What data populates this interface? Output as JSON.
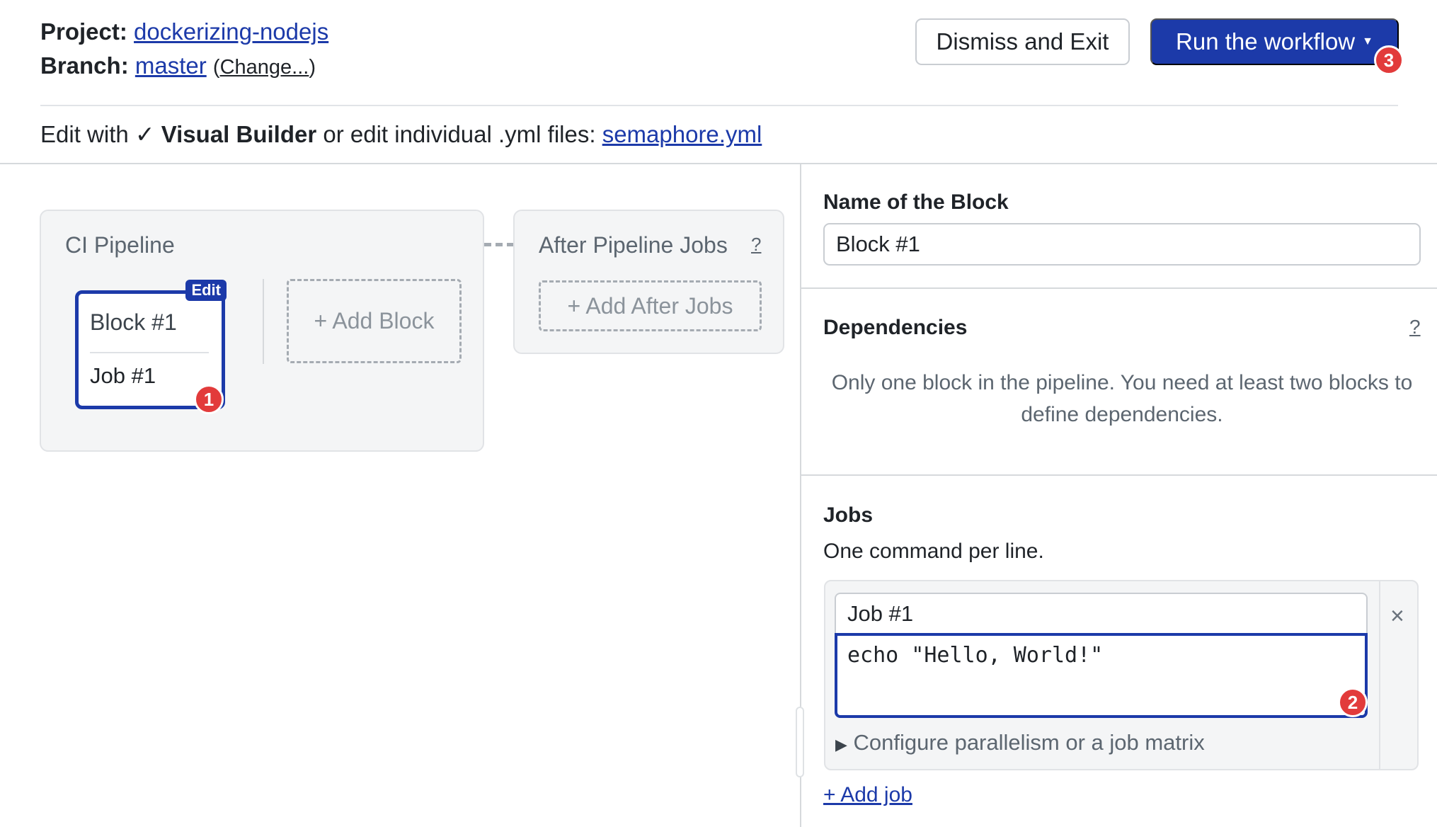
{
  "header": {
    "project_label": "Project:",
    "project_name": "dockerizing-nodejs",
    "branch_label": "Branch:",
    "branch_name": "master",
    "change_open": "(",
    "change_link": "Change...",
    "change_close": ")",
    "dismiss_label": "Dismiss and Exit",
    "run_label": "Run the workflow",
    "run_badge": "3"
  },
  "edit_mode": {
    "prefix": "Edit with",
    "check": "✓",
    "mode": "Visual Builder",
    "middle": "or edit individual .yml files:",
    "file": "semaphore.yml"
  },
  "pipeline": {
    "title": "CI Pipeline",
    "block": {
      "edit_tag": "Edit",
      "name": "Block #1",
      "job": "Job #1",
      "badge": "1"
    },
    "add_block": "+ Add Block"
  },
  "after_jobs": {
    "title": "After Pipeline Jobs",
    "help": "?",
    "add": "+ Add After Jobs"
  },
  "right_panel": {
    "name_title": "Name of the Block",
    "name_value": "Block #1",
    "dependencies_title": "Dependencies",
    "dependencies_help": "?",
    "dependencies_text": "Only one block in the pipeline. You need at least two blocks to define dependencies.",
    "jobs_title": "Jobs",
    "jobs_subtitle": "One command per line.",
    "job": {
      "name": "Job #1",
      "command": "echo \"Hello, World!\"",
      "badge": "2",
      "close": "×",
      "configure": "Configure parallelism or a job matrix",
      "configure_arrow": "▶"
    },
    "add_job": "+ Add job"
  },
  "colors": {
    "accent": "#1c3aa9",
    "badge": "#e23b3b",
    "panel_bg": "#f4f5f6"
  }
}
